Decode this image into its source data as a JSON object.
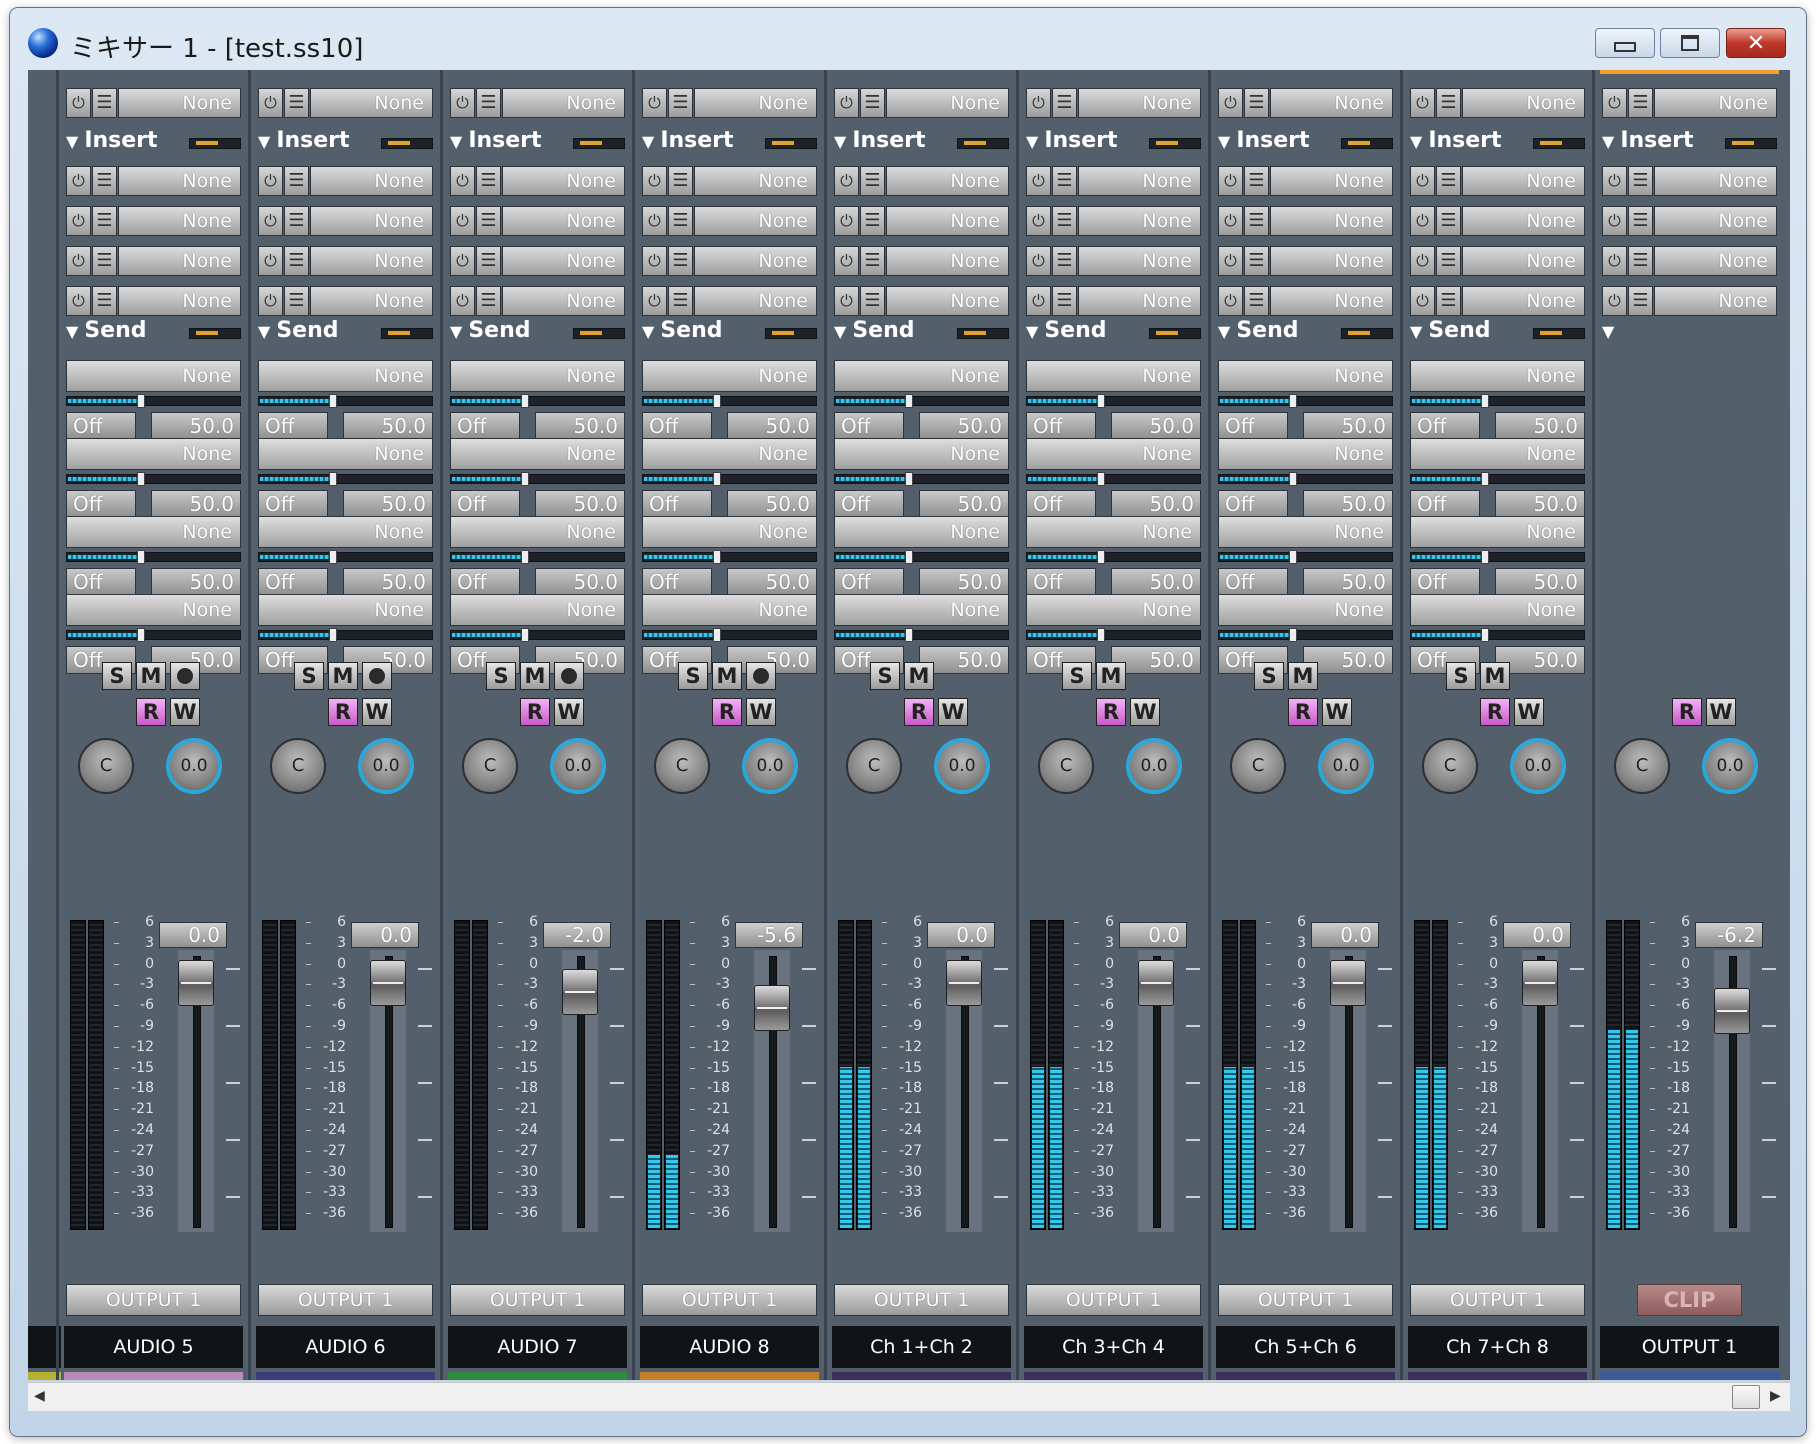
{
  "window": {
    "title": "ミキサー 1 - [test.ss10]",
    "minimize_glyph": "▭",
    "maximize_glyph": "▣",
    "close_glyph": "✕"
  },
  "labels": {
    "insert": "Insert",
    "send": "Send",
    "none": "None",
    "off": "Off",
    "send_level": "50.0",
    "solo": "S",
    "mute": "M",
    "read": "R",
    "write": "W",
    "pan_center": "C",
    "width_value": "0.0",
    "output_route": "OUTPUT 1",
    "clip": "CLIP",
    "triangle": "▼",
    "power_glyph": "⏻",
    "menu_glyph": "☰"
  },
  "meter_scale": [
    "6",
    "3",
    "0",
    "-3",
    "-6",
    "-9",
    "-12",
    "-15",
    "-18",
    "-21",
    "-24",
    "-27",
    "-30",
    "-33",
    "-36"
  ],
  "channels": [
    {
      "name": "AUDIO 5",
      "volume": "0.0",
      "fader_db": 0,
      "meter_db": -100,
      "color": "#b58ab6",
      "has_rec": true,
      "has_send": true
    },
    {
      "name": "AUDIO 6",
      "volume": "0.0",
      "fader_db": 0,
      "meter_db": -100,
      "color": "#3c3c78",
      "has_rec": true,
      "has_send": true
    },
    {
      "name": "AUDIO 7",
      "volume": "-2.0",
      "fader_db": -2,
      "meter_db": -100,
      "color": "#2f8a3e",
      "has_rec": true,
      "has_send": true
    },
    {
      "name": "AUDIO 8",
      "volume": "-5.6",
      "fader_db": -5.6,
      "meter_db": -26,
      "color": "#c47f2a",
      "has_rec": true,
      "has_send": true
    },
    {
      "name": "Ch 1+Ch 2",
      "volume": "0.0",
      "fader_db": 0,
      "meter_db": -14,
      "color": "#3c2f5c",
      "has_rec": false,
      "has_send": true
    },
    {
      "name": "Ch 3+Ch 4",
      "volume": "0.0",
      "fader_db": 0,
      "meter_db": -14,
      "color": "#3c2f5c",
      "has_rec": false,
      "has_send": true
    },
    {
      "name": "Ch 5+Ch 6",
      "volume": "0.0",
      "fader_db": 0,
      "meter_db": -14,
      "color": "#3c2f5c",
      "has_rec": false,
      "has_send": true
    },
    {
      "name": "Ch 7+Ch 8",
      "volume": "0.0",
      "fader_db": 0,
      "meter_db": -14,
      "color": "#3c2f5c",
      "has_rec": false,
      "has_send": true
    },
    {
      "name": "OUTPUT 1",
      "volume": "-6.2",
      "fader_db": -6.2,
      "meter_db": -9,
      "color": "#3a5a9a",
      "has_rec": false,
      "has_send": false,
      "is_master": true
    }
  ]
}
